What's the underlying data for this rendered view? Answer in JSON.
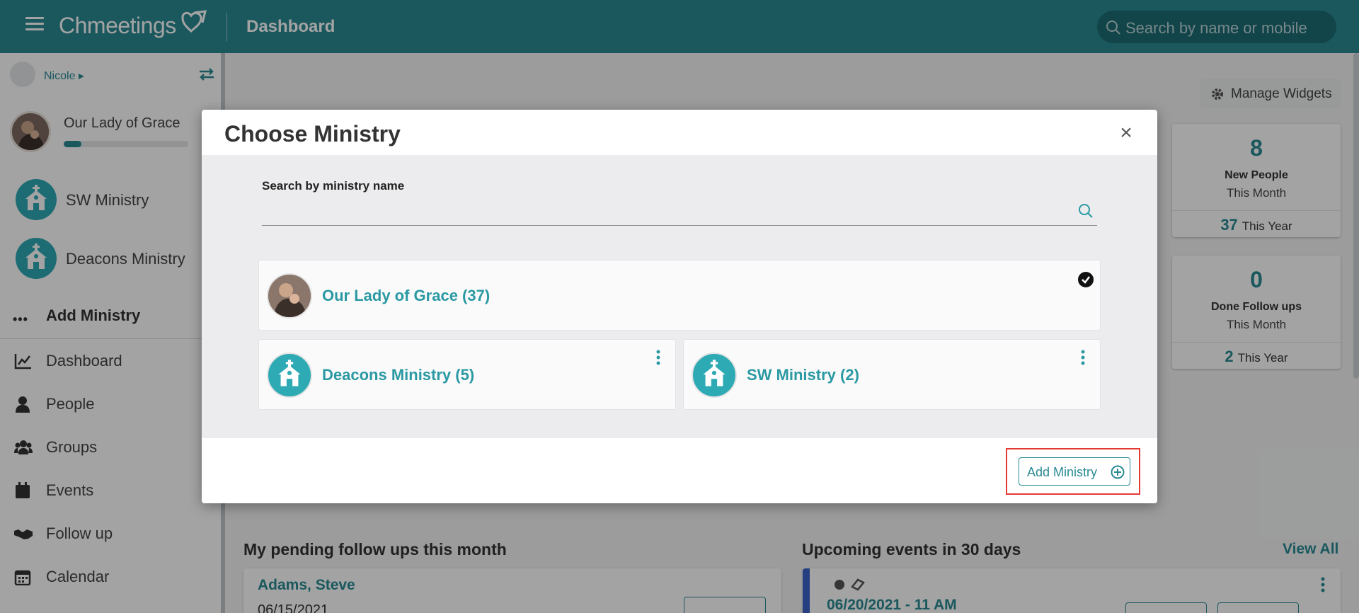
{
  "topbar": {
    "app_name": "Chmeetings",
    "page_title": "Dashboard",
    "search_placeholder": "Search by name or mobile",
    "bg_color": "#2a8a94"
  },
  "sidebar": {
    "user_name": "Nicole",
    "church_name": "Our Lady of Grace",
    "church_progress": 0.14,
    "ministries": [
      {
        "label": "SW Ministry",
        "icon": "church-icon"
      },
      {
        "label": "Deacons Ministry",
        "icon": "church-icon"
      }
    ],
    "add_ministry_label": "Add Ministry",
    "nav": [
      {
        "label": "Dashboard",
        "icon": "chart-icon"
      },
      {
        "label": "People",
        "icon": "person-icon"
      },
      {
        "label": "Groups",
        "icon": "groups-icon"
      },
      {
        "label": "Events",
        "icon": "calendar-icon"
      },
      {
        "label": "Follow up",
        "icon": "handshake-icon"
      },
      {
        "label": "Calendar",
        "icon": "calendar-grid-icon"
      }
    ]
  },
  "main": {
    "manage_widgets_label": "Manage Widgets",
    "stats": [
      {
        "value": "8",
        "label": "New People",
        "period": "This Month",
        "year_value": "37",
        "year_label": "This Year"
      },
      {
        "value": "0",
        "label": "Done Follow ups",
        "period": "This Month",
        "year_value": "2",
        "year_label": "This Year"
      }
    ],
    "pending_title": "My pending follow ups this month",
    "pending_person": "Adams, Steve",
    "pending_date": "06/15/2021",
    "events_title": "Upcoming events in 30 days",
    "view_all_label": "View All",
    "event_date": "06/20/2021 - 11 AM"
  },
  "modal": {
    "title": "Choose Ministry",
    "search_label": "Search by ministry name",
    "search_value": "",
    "ministries": [
      {
        "label": "Our Lady of Grace (37)",
        "selected": true
      },
      {
        "label": "Deacons Ministry (5)",
        "selected": false
      },
      {
        "label": "SW Ministry (2)",
        "selected": false
      }
    ],
    "add_button_label": "Add Ministry",
    "accent_color": "#2a99a3",
    "highlight_color": "#e53935"
  }
}
